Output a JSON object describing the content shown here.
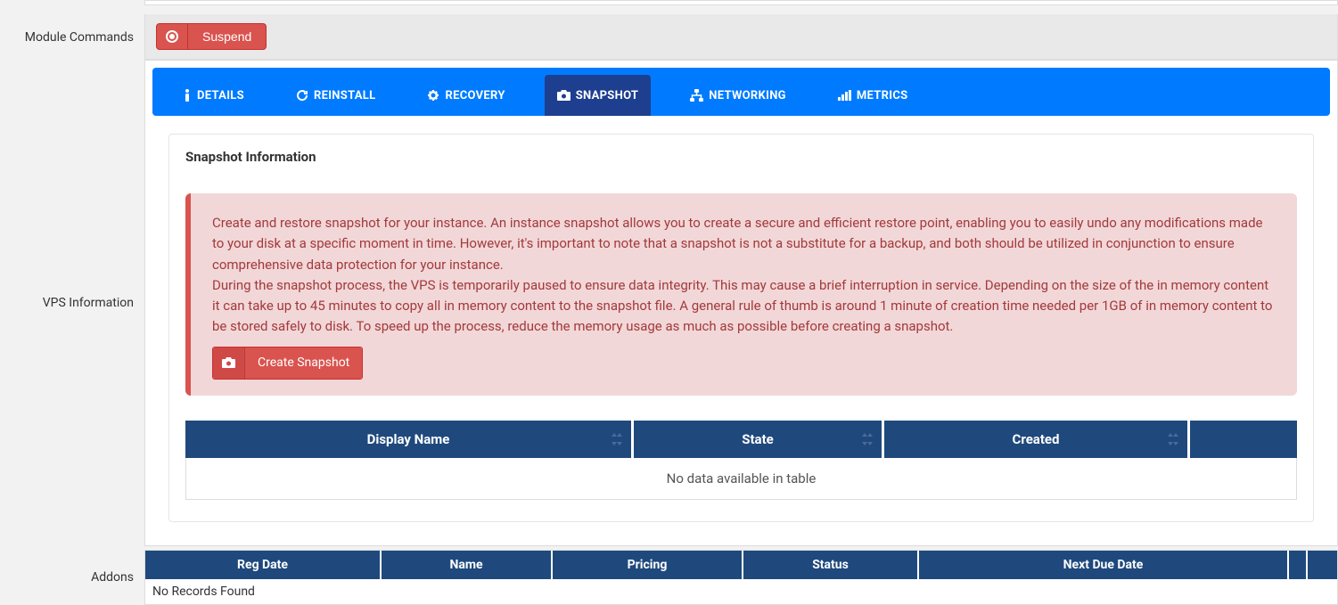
{
  "labels": {
    "module_commands": "Module Commands",
    "vps_information": "VPS Information",
    "addons": "Addons"
  },
  "module_commands": {
    "suspend_label": "Suspend"
  },
  "tabs": {
    "details": "DETAILS",
    "reinstall": "REINSTALL",
    "recovery": "RECOVERY",
    "snapshot": "SNAPSHOT",
    "networking": "NETWORKING",
    "metrics": "METRICS"
  },
  "panel": {
    "title": "Snapshot Information",
    "alert_p1": "Create and restore snapshot for your instance. An instance snapshot allows you to create a secure and efficient restore point, enabling you to easily undo any modifications made to your disk at a specific moment in time. However, it's important to note that a snapshot is not a substitute for a backup, and both should be utilized in conjunction to ensure comprehensive data protection for your instance.",
    "alert_p2": "During the snapshot process, the VPS is temporarily paused to ensure data integrity. This may cause a brief interruption in service. Depending on the size of the in memory content it can take up to 45 minutes to copy all in memory content to the snapshot file. A general rule of thumb is around 1 minute of creation time needed per 1GB of in memory content to be stored safely to disk. To speed up the process, reduce the memory usage as much as possible before creating a snapshot.",
    "create_snapshot_label": "Create Snapshot"
  },
  "snapshot_table": {
    "columns": {
      "display_name": "Display Name",
      "state": "State",
      "created": "Created"
    },
    "empty": "No data available in table"
  },
  "addons_table": {
    "columns": {
      "reg_date": "Reg Date",
      "name": "Name",
      "pricing": "Pricing",
      "status": "Status",
      "next_due_date": "Next Due Date"
    },
    "empty": "No Records Found"
  }
}
